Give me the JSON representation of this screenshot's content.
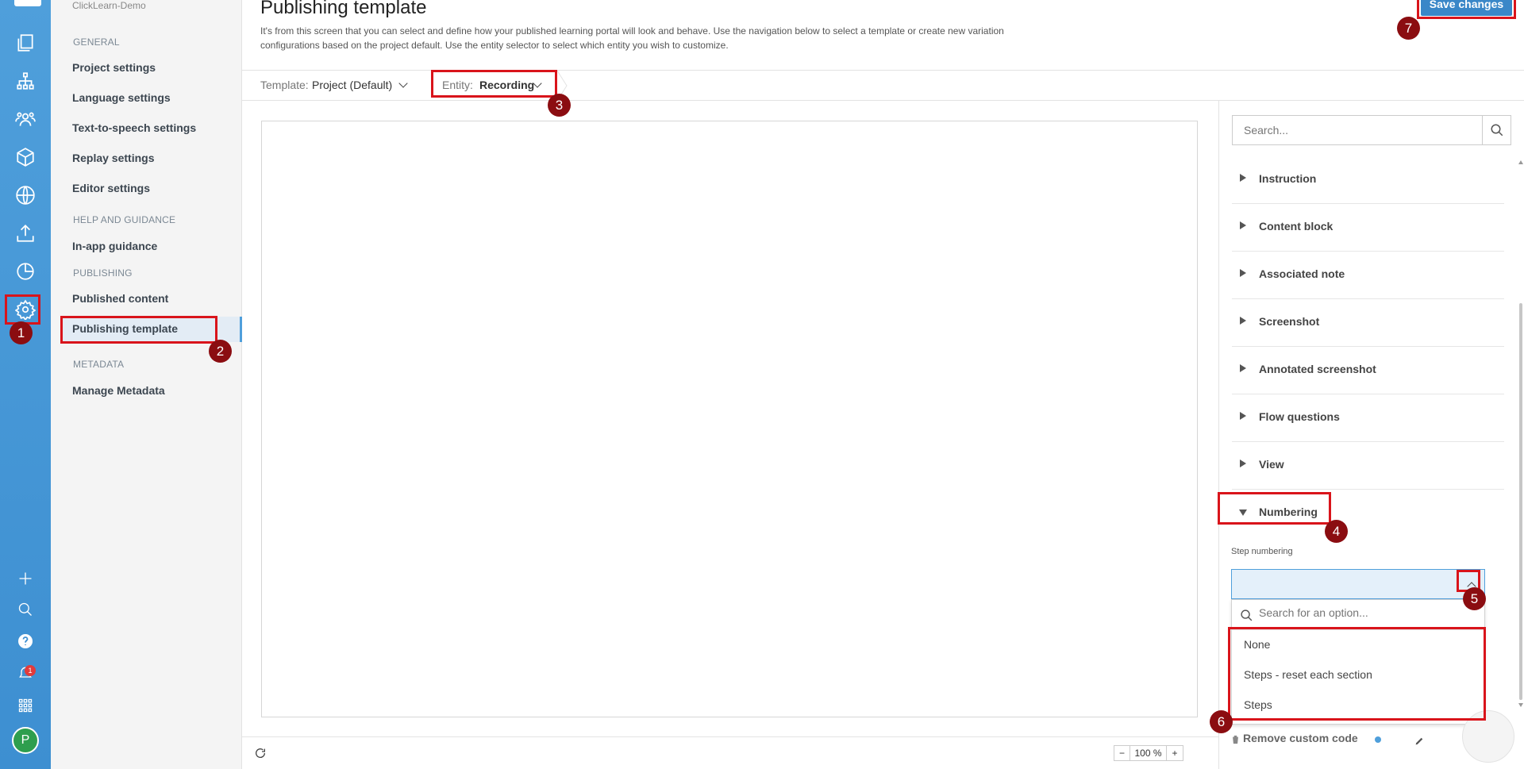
{
  "sidebar": {
    "project_name": "ClickLearn-Demo",
    "sections": [
      {
        "heading": "GENERAL",
        "items": [
          "Project settings",
          "Language settings",
          "Text-to-speech settings",
          "Replay settings",
          "Editor settings"
        ]
      },
      {
        "heading": "HELP AND GUIDANCE",
        "items": [
          "In-app guidance"
        ]
      },
      {
        "heading": "PUBLISHING",
        "items": [
          "Published content",
          "Publishing template"
        ]
      },
      {
        "heading": "METADATA",
        "items": [
          "Manage Metadata"
        ]
      }
    ],
    "active_item": "Publishing template"
  },
  "rail": {
    "icons": [
      "logo",
      "documents-icon",
      "sitemap-icon",
      "users-icon",
      "box-icon",
      "globe-icon",
      "upload-icon",
      "chart-icon",
      "settings-icon",
      "plus-icon",
      "search-icon",
      "help-icon",
      "notification-icon",
      "apps-icon"
    ],
    "notification_count": "1",
    "avatar_initial": "P"
  },
  "header": {
    "title": "Publishing template",
    "description": "It's from this screen that you can select and define how your published learning portal will look and behave. Use the navigation below to select a template or create new variation configurations based on the project default. Use the entity selector to select which entity you wish to customize.",
    "save_label": "Save changes"
  },
  "toolbar": {
    "template_label": "Template:",
    "template_value": "Project (Default)",
    "entity_label": "Entity:",
    "entity_value": "Recording"
  },
  "zoom": {
    "minus": "−",
    "value": "100 %",
    "plus": "+"
  },
  "panel": {
    "search_placeholder": "Search...",
    "sections": [
      "Instruction",
      "Content block",
      "Associated note",
      "Screenshot",
      "Annotated screenshot",
      "Flow questions",
      "View",
      "Numbering"
    ],
    "expanded_section": "Numbering",
    "field_label": "Step numbering",
    "dropdown_search_placeholder": "Search for an option...",
    "options": [
      "None",
      "Steps - reset each section",
      "Steps"
    ],
    "remove_code_label": "Remove custom code"
  },
  "annotations": [
    "1",
    "2",
    "3",
    "4",
    "5",
    "6",
    "7"
  ],
  "colors": {
    "accent": "#4f9fdb",
    "highlight": "#d9141b",
    "marker": "#8b0d11"
  }
}
